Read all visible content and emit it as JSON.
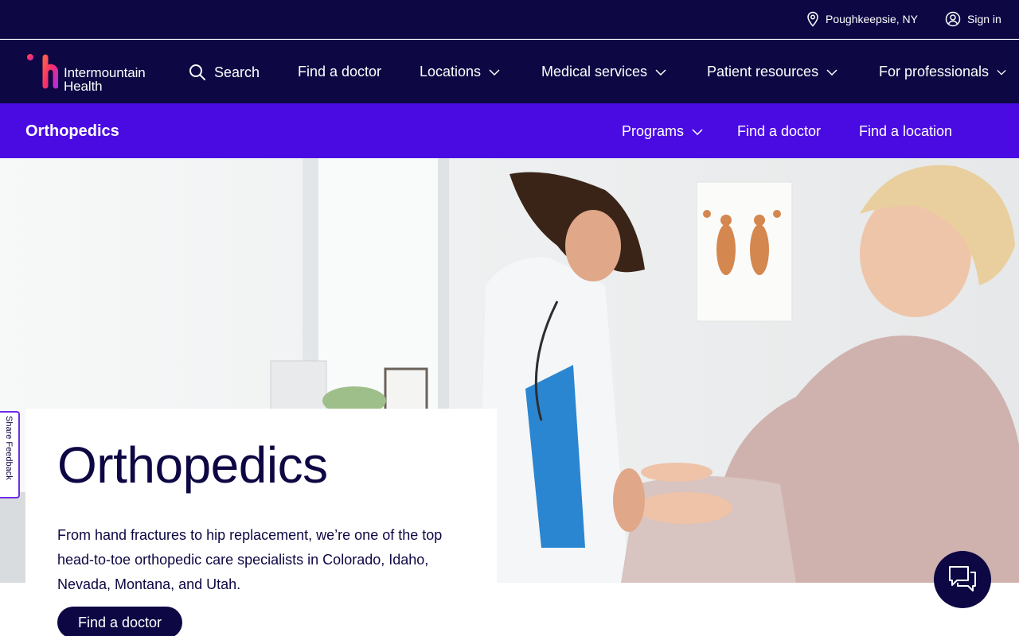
{
  "utility": {
    "location": "Poughkeepsie, NY",
    "signin": "Sign in"
  },
  "brand": {
    "name_line1": "Intermountain",
    "name_line2": "Health",
    "colors": {
      "navy": "#0d0844",
      "purple": "#4a0be3",
      "logo_pink": "#f72e6b",
      "logo_magenta": "#b92bd6"
    }
  },
  "nav": {
    "search": "Search",
    "find_doctor": "Find a doctor",
    "locations": "Locations",
    "medical_services": "Medical services",
    "patient_resources": "Patient resources",
    "for_professionals": "For professionals"
  },
  "subnav": {
    "title": "Orthopedics",
    "programs": "Programs",
    "find_doctor": "Find a doctor",
    "find_location": "Find a location"
  },
  "hero": {
    "title": "Orthopedics",
    "description": "From hand fractures to hip replacement, we’re one of the top head-to-toe orthopedic care specialists in Colorado, Idaho, Nevada, Montana, and Utah.",
    "button": "Find a doctor"
  },
  "feedback": {
    "label": "Share Feedback"
  },
  "icons": [
    "location-pin-icon",
    "user-icon",
    "search-icon",
    "chevron-down-icon",
    "chat-icon"
  ]
}
